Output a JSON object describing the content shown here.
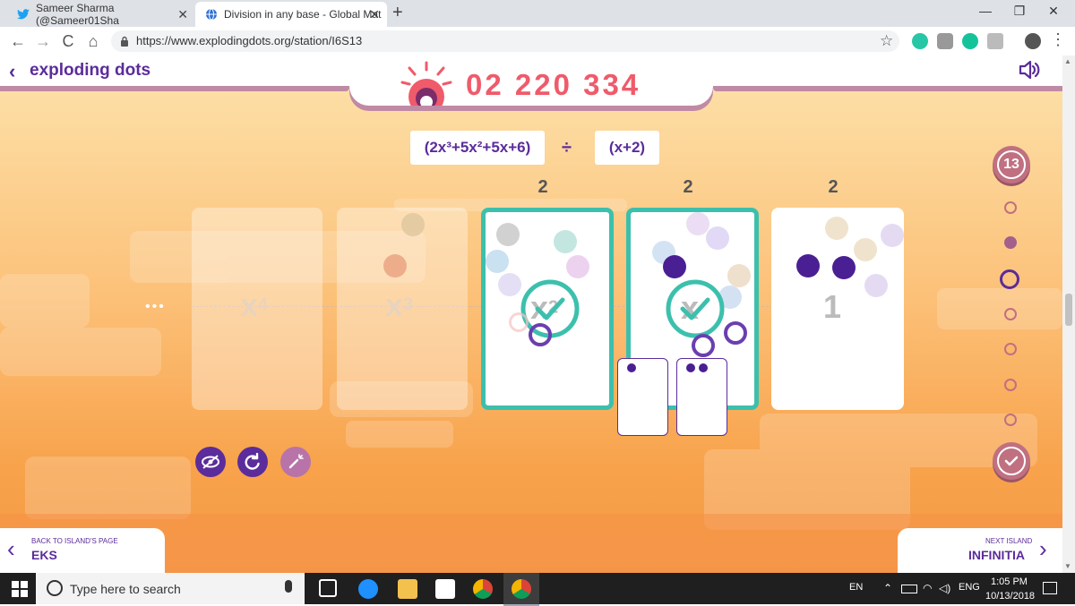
{
  "browser": {
    "tabs": [
      {
        "label": "Sameer Sharma (@Sameer01Sha",
        "icon": "twitter-icon"
      },
      {
        "label": "Division in any base - Global Mat",
        "icon": "globe-icon"
      }
    ],
    "new_tab": "+",
    "window_controls": {
      "minimize": "—",
      "maximize": "❐",
      "close": "✕"
    },
    "url": "https://www.explodingdots.org/station/I6S13",
    "nav": {
      "back": "←",
      "forward": "→",
      "reload": "C",
      "home": "⌂"
    }
  },
  "header": {
    "back_chevron": "‹",
    "title": "exploding dots",
    "score": "02 220 334",
    "audio_icon": "speaker-icon"
  },
  "equation": {
    "dividend": "(2x³+5x²+5x+6)",
    "divide_sign": "÷",
    "divisor": "(x+2)"
  },
  "columns": [
    {
      "count": "",
      "label": "x",
      "exp": "4",
      "state": "faded"
    },
    {
      "count": "",
      "label": "x",
      "exp": "3",
      "state": "faded"
    },
    {
      "count": "2",
      "label": "x",
      "exp": "2",
      "state": "active"
    },
    {
      "count": "2",
      "label": "x",
      "exp": "",
      "state": "active"
    },
    {
      "count": "2",
      "label": "1",
      "exp": "",
      "state": "plain"
    }
  ],
  "ellipsis": "•••",
  "controls": {
    "hide": "eye-slash-icon",
    "reset": "refresh-icon",
    "wand": "magic-wand-icon"
  },
  "progress": {
    "level": "13",
    "done_icon": "check-icon"
  },
  "footer": {
    "back_small": "BACK TO ISLAND'S PAGE",
    "back_big": "EKS",
    "next_small": "NEXT ISLAND",
    "next_big": "INFINITIA"
  },
  "taskbar": {
    "search_placeholder": "Type here to search",
    "lang": "EN",
    "keyboard": "ENG",
    "time": "1:05 PM",
    "date": "10/13/2018"
  },
  "colors": {
    "brand_purple": "#5b2c9b",
    "score_red": "#ef5b6b",
    "teal": "#3cc0ad",
    "orange_bg": "#f8a24b"
  }
}
